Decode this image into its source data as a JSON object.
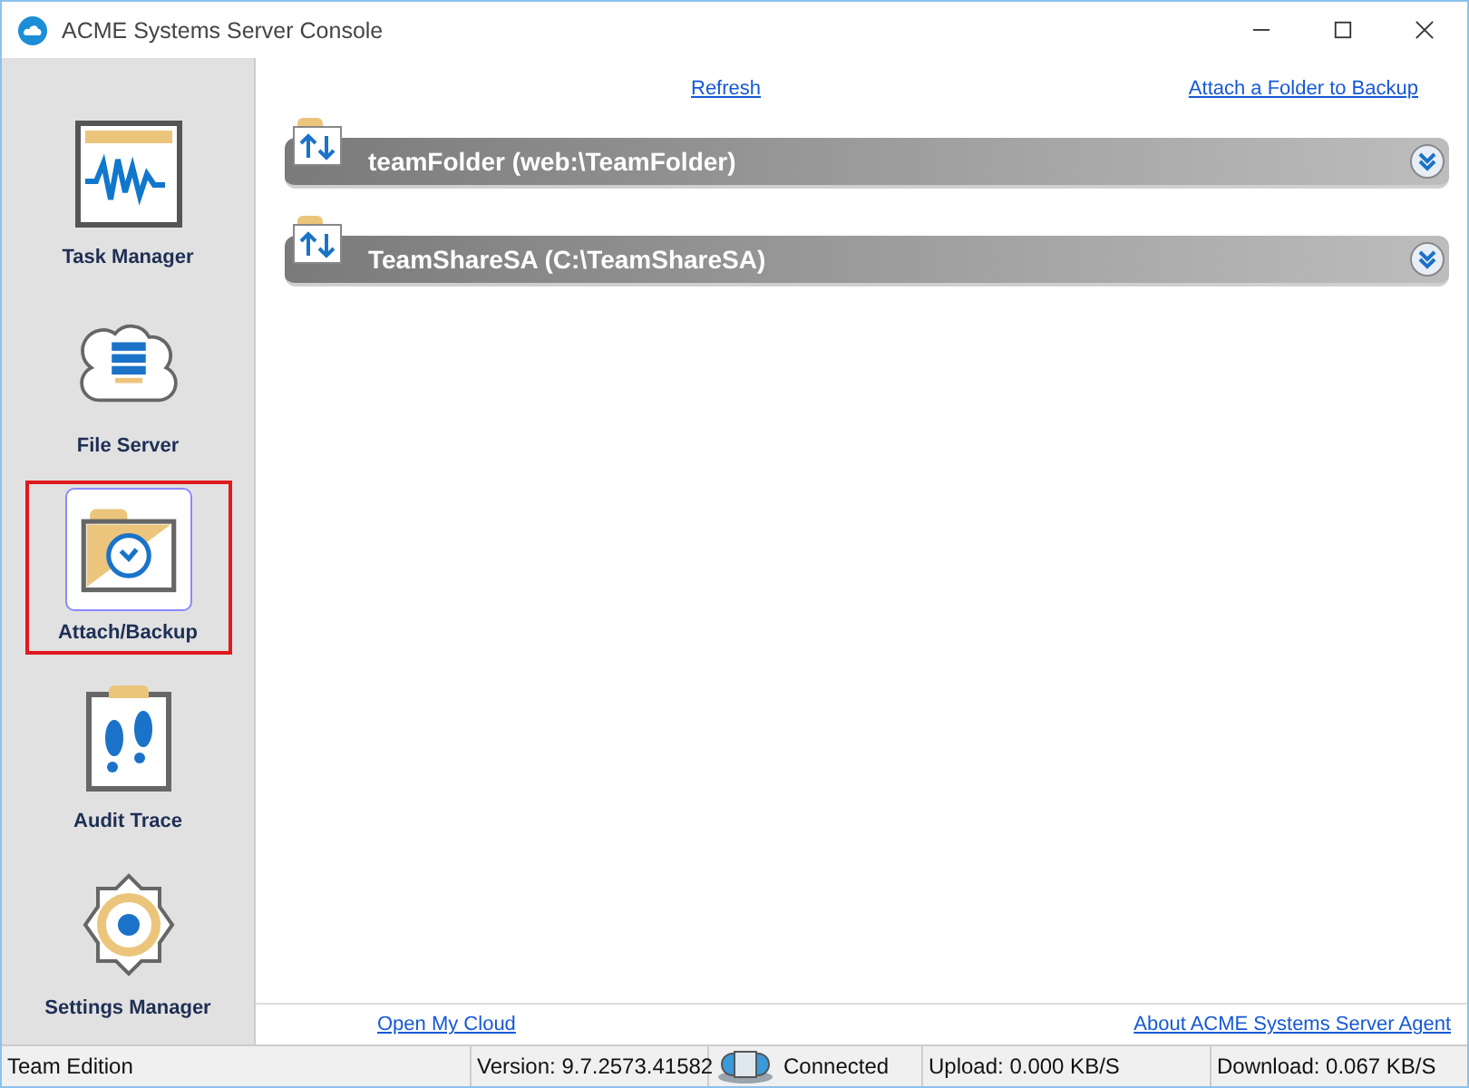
{
  "window": {
    "title": "ACME Systems Server Console"
  },
  "sidebar": {
    "items": [
      {
        "label": "Task Manager",
        "kind": "monitor",
        "selected": false
      },
      {
        "label": "File Server",
        "kind": "server",
        "selected": false
      },
      {
        "label": "Attach/Backup",
        "kind": "backup",
        "selected": true
      },
      {
        "label": "Audit Trace",
        "kind": "audit",
        "selected": false
      },
      {
        "label": "Settings Manager",
        "kind": "settings",
        "selected": false
      }
    ]
  },
  "toolbar": {
    "links": [
      "Refresh",
      "Attach a Folder to Backup"
    ]
  },
  "folders": [
    {
      "name": "teamFolder (web:\\TeamFolder)"
    },
    {
      "name": "TeamShareSA (C:\\TeamShareSA)"
    }
  ],
  "footer": {
    "links": [
      "Open My Cloud",
      "About ACME Systems Server Agent"
    ]
  },
  "status_bar": {
    "edition": "Team Edition",
    "version": "Version: 9.7.2573.41582",
    "connection": "Connected",
    "upload": "Upload: 0.000 KB/S",
    "download": "Download: 0.067 KB/S"
  }
}
